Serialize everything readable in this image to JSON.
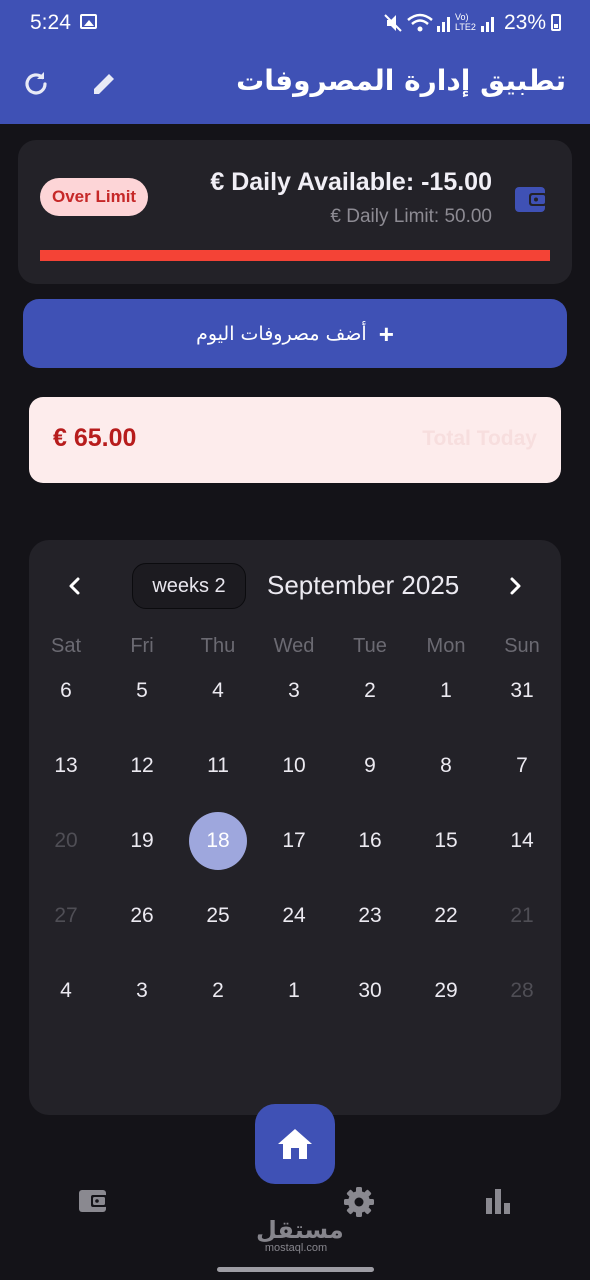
{
  "status_bar": {
    "time": "5:24",
    "icons": "🔇 📶 Vo) LTE2 📶",
    "battery": "23%"
  },
  "app_bar": {
    "title": "تطبيق إدارة المصروفات",
    "refresh_icon": "refresh-icon",
    "edit_icon": "edit-icon"
  },
  "limit_card": {
    "badge": "Over Limit",
    "daily_available": "€ Daily Available: -15.00",
    "daily_limit": "€ Daily Limit: 50.00",
    "progress_percent": 100,
    "progress_color": "#f44336",
    "icon": "wallet-icon"
  },
  "add_expense": {
    "label": "أضف مصروفات اليوم",
    "icon": "plus-icon"
  },
  "total_today": {
    "amount": "€ 65.00",
    "label": "Total Today"
  },
  "calendar": {
    "weeks_toggle": "weeks 2",
    "month_title": "September 2025",
    "weekdays": [
      "Sat",
      "Fri",
      "Thu",
      "Wed",
      "Tue",
      "Mon",
      "Sun"
    ],
    "rows": [
      [
        {
          "d": "6",
          "m": false
        },
        {
          "d": "5",
          "m": false
        },
        {
          "d": "4",
          "m": false
        },
        {
          "d": "3",
          "m": false
        },
        {
          "d": "2",
          "m": false
        },
        {
          "d": "1",
          "m": false
        },
        {
          "d": "31",
          "m": false
        }
      ],
      [
        {
          "d": "13",
          "m": false
        },
        {
          "d": "12",
          "m": false
        },
        {
          "d": "11",
          "m": false
        },
        {
          "d": "10",
          "m": false
        },
        {
          "d": "9",
          "m": false
        },
        {
          "d": "8",
          "m": false
        },
        {
          "d": "7",
          "m": false
        }
      ],
      [
        {
          "d": "20",
          "m": true
        },
        {
          "d": "19",
          "m": false
        },
        {
          "d": "18",
          "m": false,
          "selected": true
        },
        {
          "d": "17",
          "m": false
        },
        {
          "d": "16",
          "m": false
        },
        {
          "d": "15",
          "m": false
        },
        {
          "d": "14",
          "m": false
        }
      ],
      [
        {
          "d": "27",
          "m": true
        },
        {
          "d": "26",
          "m": false
        },
        {
          "d": "25",
          "m": false
        },
        {
          "d": "24",
          "m": false
        },
        {
          "d": "23",
          "m": false
        },
        {
          "d": "22",
          "m": false
        },
        {
          "d": "21",
          "m": true
        }
      ],
      [
        {
          "d": "4",
          "m": false
        },
        {
          "d": "3",
          "m": false
        },
        {
          "d": "2",
          "m": false
        },
        {
          "d": "1",
          "m": false
        },
        {
          "d": "30",
          "m": false
        },
        {
          "d": "29",
          "m": false
        },
        {
          "d": "28",
          "m": true
        }
      ]
    ]
  },
  "bottom_nav": {
    "items": [
      "wallet-icon",
      "home-icon",
      "gear-icon",
      "bar-chart-icon"
    ]
  },
  "watermark": {
    "arabic": "مستقل",
    "latin": "mostaql.com"
  },
  "colors": {
    "primary": "#3f51b5",
    "background": "#141318",
    "card": "#232228",
    "danger": "#f44336",
    "badge_bg": "#fdd5d7",
    "total_bg": "#fdecec"
  }
}
